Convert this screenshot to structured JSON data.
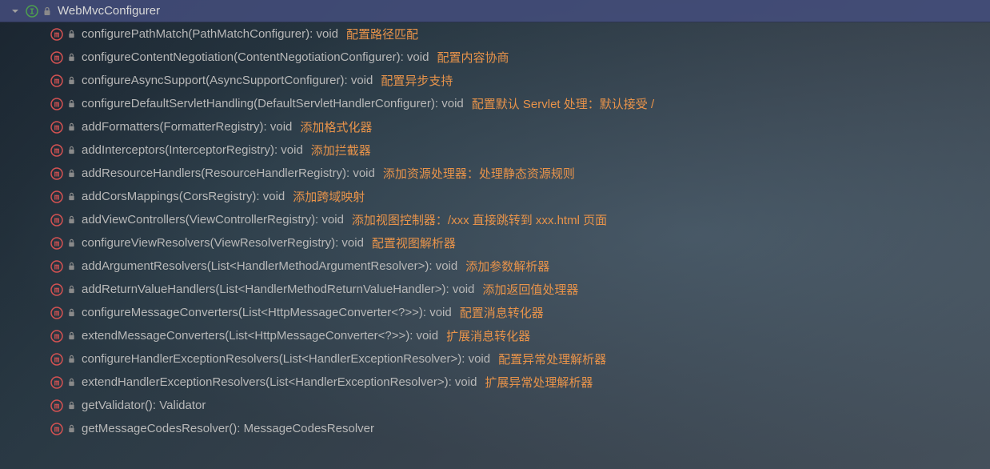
{
  "header": {
    "title": "WebMvcConfigurer"
  },
  "methods": [
    {
      "signature": "configurePathMatch(PathMatchConfigurer): void",
      "annotation": "配置路径匹配"
    },
    {
      "signature": "configureContentNegotiation(ContentNegotiationConfigurer): void",
      "annotation": "配置内容协商"
    },
    {
      "signature": "configureAsyncSupport(AsyncSupportConfigurer): void",
      "annotation": "配置异步支持"
    },
    {
      "signature": "configureDefaultServletHandling(DefaultServletHandlerConfigurer): void",
      "annotation": "配置默认 Servlet 处理：默认接受 /"
    },
    {
      "signature": "addFormatters(FormatterRegistry): void",
      "annotation": "添加格式化器"
    },
    {
      "signature": "addInterceptors(InterceptorRegistry): void",
      "annotation": "添加拦截器"
    },
    {
      "signature": "addResourceHandlers(ResourceHandlerRegistry): void",
      "annotation": "添加资源处理器：处理静态资源规则"
    },
    {
      "signature": "addCorsMappings(CorsRegistry): void",
      "annotation": "添加跨域映射"
    },
    {
      "signature": "addViewControllers(ViewControllerRegistry): void",
      "annotation": "添加视图控制器：/xxx 直接跳转到 xxx.html 页面"
    },
    {
      "signature": "configureViewResolvers(ViewResolverRegistry): void",
      "annotation": "配置视图解析器"
    },
    {
      "signature": "addArgumentResolvers(List<HandlerMethodArgumentResolver>): void",
      "annotation": "添加参数解析器"
    },
    {
      "signature": "addReturnValueHandlers(List<HandlerMethodReturnValueHandler>): void",
      "annotation": "添加返回值处理器"
    },
    {
      "signature": "configureMessageConverters(List<HttpMessageConverter<?>>): void",
      "annotation": "配置消息转化器"
    },
    {
      "signature": "extendMessageConverters(List<HttpMessageConverter<?>>): void",
      "annotation": "扩展消息转化器"
    },
    {
      "signature": "configureHandlerExceptionResolvers(List<HandlerExceptionResolver>): void",
      "annotation": "配置异常处理解析器"
    },
    {
      "signature": "extendHandlerExceptionResolvers(List<HandlerExceptionResolver>): void",
      "annotation": "扩展异常处理解析器"
    },
    {
      "signature": "getValidator(): Validator",
      "annotation": ""
    },
    {
      "signature": "getMessageCodesResolver(): MessageCodesResolver",
      "annotation": ""
    }
  ],
  "colors": {
    "methodIcon": "#d45252",
    "interfaceIcon": "#4ea04e",
    "lockIcon": "#8a8a8a",
    "annotation": "#e8934a",
    "signature": "#b8b8b8"
  }
}
